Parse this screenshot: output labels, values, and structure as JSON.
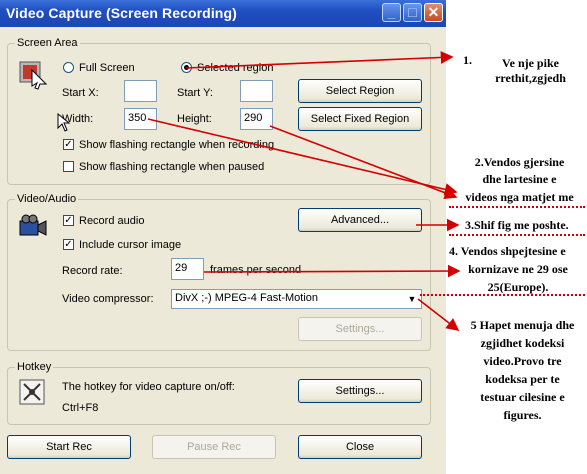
{
  "window": {
    "title": "Video Capture (Screen Recording)"
  },
  "screen_area": {
    "group_label": "Screen Area",
    "full_screen": "Full Screen",
    "selected_region": "Selected region",
    "start_x_label": "Start X:",
    "start_y_label": "Start Y:",
    "start_x_value": "",
    "start_y_value": "",
    "width_label": "Width:",
    "width_value": "350",
    "height_label": "Height:",
    "height_value": "290",
    "select_region": "Select Region",
    "select_fixed_region": "Select Fixed Region",
    "show_flash_recording": "Show flashing rectangle when recording",
    "show_flash_paused": "Show flashing rectangle when paused"
  },
  "video_audio": {
    "group_label": "Video/Audio",
    "record_audio": "Record audio",
    "include_cursor": "Include cursor image",
    "advanced": "Advanced...",
    "record_rate_label": "Record rate:",
    "record_rate_value": "29",
    "frames_per_second": "frames per second",
    "video_compressor_label": "Video compressor:",
    "video_compressor_value": "DivX ;-) MPEG-4 Fast-Motion",
    "settings": "Settings..."
  },
  "hotkey": {
    "group_label": "Hotkey",
    "description": "The hotkey for video capture on/off:",
    "key": "Ctrl+F8",
    "settings": "Settings..."
  },
  "footer": {
    "start_rec": "Start Rec",
    "pause_rec": "Pause Rec",
    "close": "Close"
  },
  "annotations": {
    "a1_line1": "1.",
    "a1_line2": "Ve nje pike",
    "a1_line3": "rrethit,zgjedh",
    "a2_line1": "2.Vendos gjersine",
    "a2_line2": "dhe lartesine e",
    "a2_line3": "videos nga matjet me",
    "a3": "3.Shif fig me poshte.",
    "a4_line1": "4.  Vendos shpejtesine e",
    "a4_line2": "kornizave ne 29 ose",
    "a4_line3": "25(Europe).",
    "a5_line1": "5 Hapet menuja dhe",
    "a5_line2": "zgjidhet kodeksi",
    "a5_line3": "video.Provo tre",
    "a5_line4": "kodeksa  per te",
    "a5_line5": "testuar cilesine e",
    "a5_line6": "figures."
  },
  "colors": {
    "arrow": "#d40000",
    "titlebar": "#1f4fc2"
  }
}
